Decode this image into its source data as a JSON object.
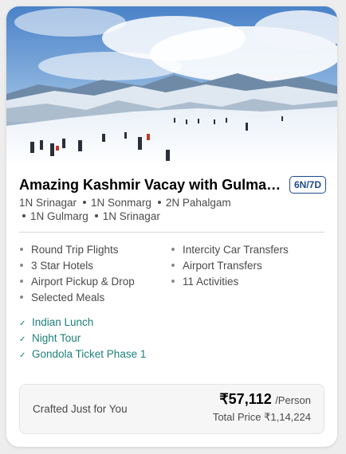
{
  "package": {
    "title": "Amazing Kashmir Vacay with Gulmar…",
    "duration": "6N/7D",
    "itinerary_line1": [
      "1N Srinagar",
      "1N Sonmarg",
      "2N Pahalgam"
    ],
    "itinerary_line2": [
      "1N Gulmarg",
      "1N Srinagar"
    ]
  },
  "inclusions": {
    "left": [
      "Round Trip Flights",
      "3 Star Hotels",
      "Airport Pickup & Drop",
      "Selected Meals"
    ],
    "right": [
      "Intercity Car Transfers",
      "Airport Transfers",
      "11 Activities"
    ]
  },
  "highlights": [
    "Indian Lunch",
    "Night Tour",
    "Gondola Ticket Phase 1"
  ],
  "pricing": {
    "crafted_label": "Crafted Just for You",
    "price": "₹57,112",
    "per_label": "/Person",
    "total": "Total Price ₹1,14,224"
  },
  "colors": {
    "accent_badge": "#1e4a8c",
    "highlight_text": "#1d7f7a"
  },
  "icons": {
    "highlight_marker": "check-icon",
    "inclusion_marker": "bullet"
  }
}
